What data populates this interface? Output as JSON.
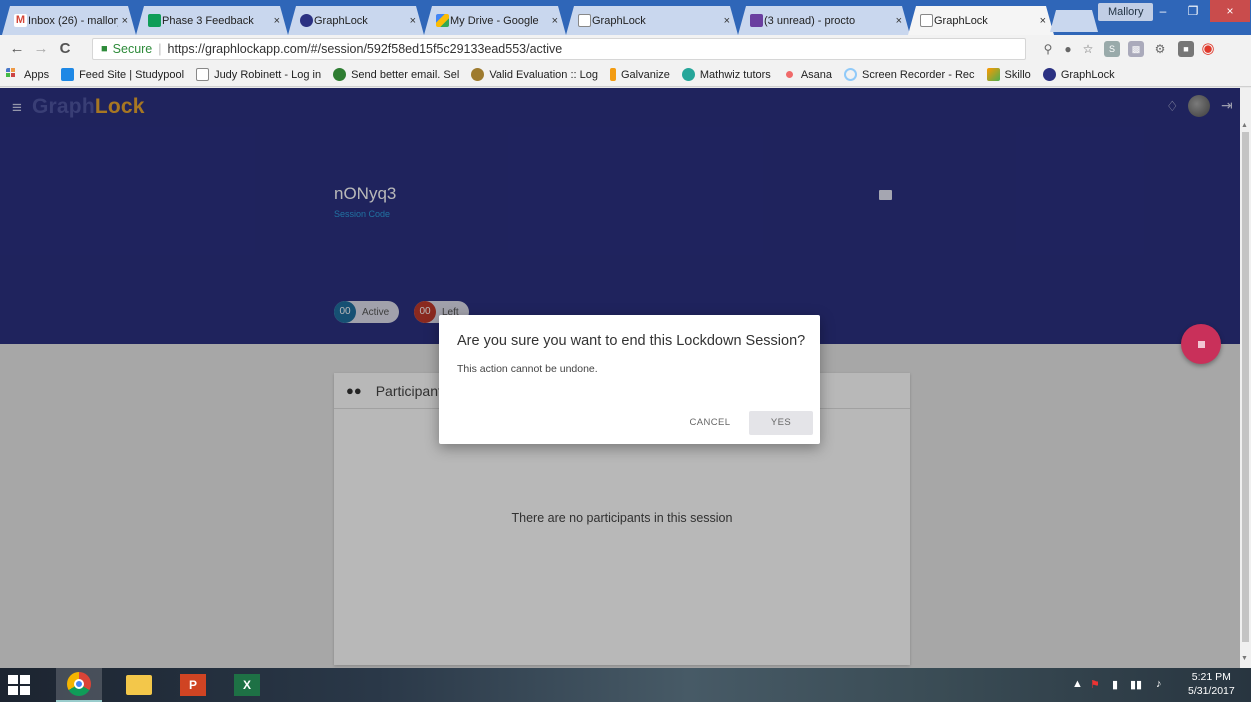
{
  "browser": {
    "tabs": [
      {
        "label": "Inbox (26) - mallory",
        "favicon_color": "#d44638",
        "active": false
      },
      {
        "label": "Phase 3 Feedback",
        "favicon_color": "#0f9d58",
        "active": false
      },
      {
        "label": "GraphLock",
        "favicon_color": "#2b3182",
        "active": false
      },
      {
        "label": "My Drive - Google",
        "favicon_color": "#f4b400",
        "active": false
      },
      {
        "label": "GraphLock",
        "favicon_color": "#999999",
        "active": false
      },
      {
        "label": "(3 unread) - procto",
        "favicon_color": "#6a3fa0",
        "active": false
      },
      {
        "label": "GraphLock",
        "favicon_color": "#999999",
        "active": true
      }
    ],
    "tab_close": "×",
    "profile_name": "Mallory",
    "window_buttons": {
      "minimize": "–",
      "maximize": "❐",
      "close": "×"
    },
    "nav": {
      "back": "←",
      "forward": "→",
      "reload": "C"
    },
    "omnibox": {
      "secure_label": "Secure",
      "separator": "|",
      "url": "https://graphlockapp.com/#/session/592f58ed15f5c29133ead553/active"
    },
    "bookmarks": [
      {
        "label": "Apps",
        "color": "#4a78c8"
      },
      {
        "label": "Feed Site | Studypool",
        "color": "#1e88e5"
      },
      {
        "label": "Judy Robinett - Log in",
        "color": "#ffffff"
      },
      {
        "label": "Send better email. Sel",
        "color": "#2e7d32"
      },
      {
        "label": "Valid Evaluation :: Log",
        "color": "#9e7b2f"
      },
      {
        "label": "Galvanize",
        "color": "#f39c12"
      },
      {
        "label": "Mathwiz tutors",
        "color": "#26a69a"
      },
      {
        "label": "Asana",
        "color": "#f06a6a"
      },
      {
        "label": "Screen Recorder - Rec",
        "color": "#90caf9"
      },
      {
        "label": "Skillo",
        "color": "#ff9800"
      },
      {
        "label": "GraphLock",
        "color": "#2b3182"
      }
    ]
  },
  "app": {
    "brand_prefix": "Graph",
    "brand_suffix": "Lock",
    "session_code": "nONyq3",
    "session_code_label": "Session Code",
    "chips": [
      {
        "count": "00",
        "label": "Active",
        "color": "#1f6fa0"
      },
      {
        "count": "00",
        "label": "Left",
        "color": "#c0392b"
      }
    ],
    "participants_title": "Participants",
    "empty_message": "There are no participants in this session"
  },
  "dialog": {
    "title": "Are you sure you want to end this Lockdown Session?",
    "message": "This action cannot be undone.",
    "cancel_label": "CANCEL",
    "yes_label": "YES"
  },
  "taskbar": {
    "time": "5:21 PM",
    "date": "5/31/2017"
  }
}
